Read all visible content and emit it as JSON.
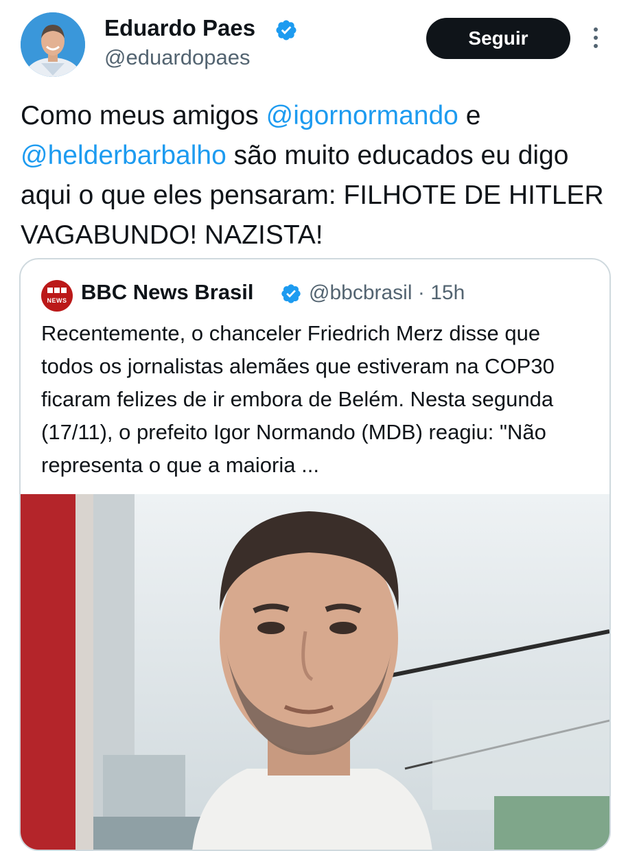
{
  "author": {
    "name": "Eduardo Paes",
    "handle": "@eduardopaes",
    "avatar_icon": "user-avatar",
    "verified_icon": "verified-badge-icon"
  },
  "actions": {
    "follow_label": "Seguir",
    "more_icon": "more-vertical-icon"
  },
  "tweet": {
    "text_1": "Como meus amigos ",
    "mention_1": "@igornormando",
    "text_2": " e ",
    "mention_2": "@helderbarbalho",
    "text_3": " são muito educados eu digo aqui o que eles pensaram:  FILHOTE DE HITLER VAGABUNDO!  NAZISTA!"
  },
  "quoted": {
    "logo_text": "NEWS",
    "name": "BBC News Brasil",
    "handle": "@bbcbrasil",
    "separator": "·",
    "time": "15h",
    "text": "Recentemente, o chanceler Friedrich Merz disse que todos os jornalistas alemães que estiveram na COP30 ficaram felizes de ir embora de Belém. Nesta segunda (17/11), o prefeito Igor Normando (MDB) reagiu: \"Não representa o que a maioria ...",
    "media_icon": "video-thumbnail"
  },
  "colors": {
    "text": "#0f1419",
    "secondary": "#536471",
    "link": "#1d9bf0",
    "verified": "#1d9bf0",
    "bbc_red": "#bb1919",
    "border": "#cfd9de"
  }
}
